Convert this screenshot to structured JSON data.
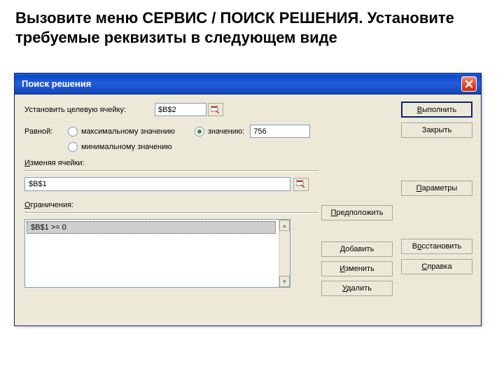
{
  "slide": {
    "heading": "Вызовите меню СЕРВИС / ПОИСК РЕШЕНИЯ. Установите требуемые реквизиты в следующем виде"
  },
  "window": {
    "title": "Поиск решения"
  },
  "labels": {
    "target_cell": "Установить целевую ячейку:",
    "equal": "Равной:",
    "max_value": "максимальному значению",
    "to_value": "значению:",
    "min_value": "минимальному значению",
    "changing": "Изменяя ячейки:",
    "constraints": "Ограничения:"
  },
  "inputs": {
    "target_cell": "$B$2",
    "value": "756",
    "changing": "$B$1"
  },
  "constraints": [
    "$B$1 >= 0"
  ],
  "buttons": {
    "execute": "Выполнить",
    "close": "Закрыть",
    "guess": "Предположить",
    "options": "Параметры",
    "add": "Добавить",
    "change": "Изменить",
    "delete": "Удалить",
    "reset": "Восстановить",
    "help": "Справка"
  },
  "radio": {
    "selected": "value"
  }
}
